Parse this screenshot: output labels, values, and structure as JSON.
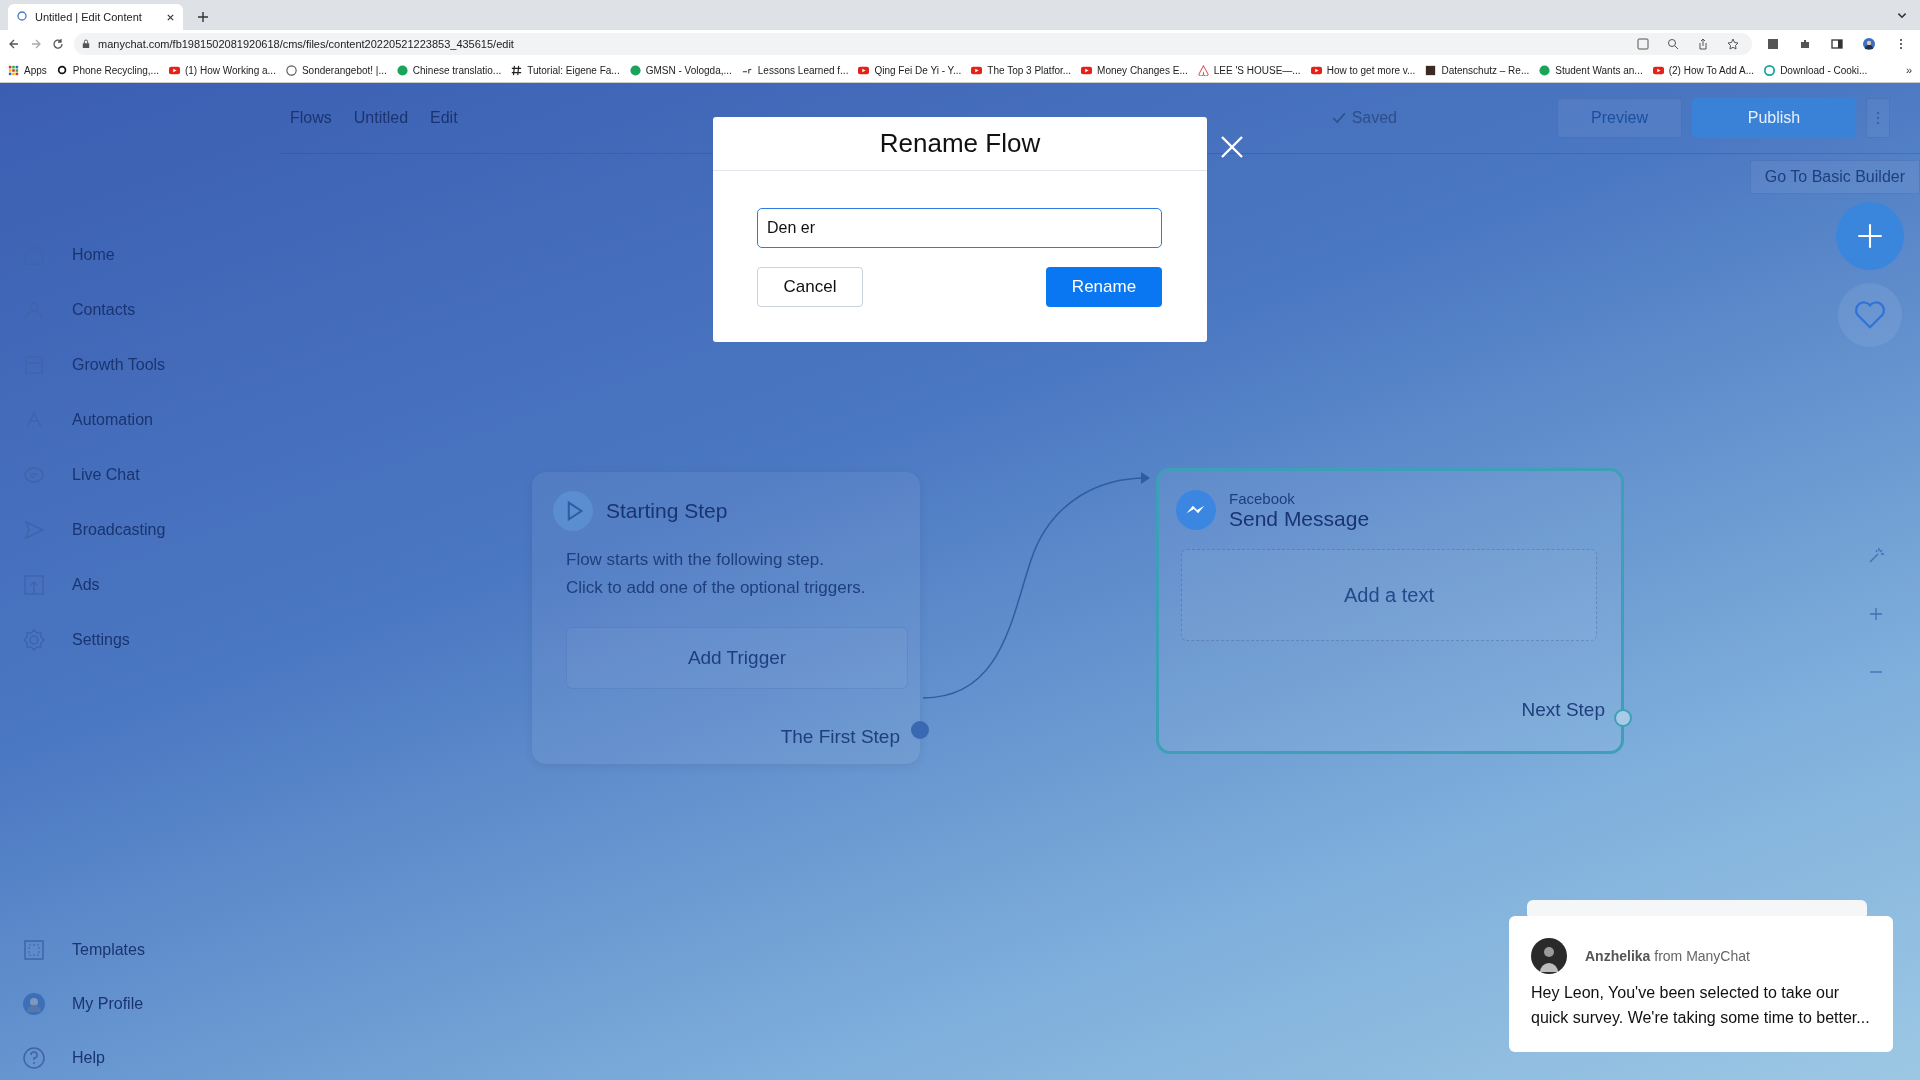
{
  "browser": {
    "tab": {
      "title": "Untitled | Edit Content"
    },
    "url": "manychat.com/fb1981502081920618/cms/files/content20220521223853_435615/edit",
    "bookmarks": [
      {
        "label": "Apps",
        "kind": "grid"
      },
      {
        "label": "Phone Recycling,...",
        "kind": "o2"
      },
      {
        "label": "(1) How Working a...",
        "kind": "youtube"
      },
      {
        "label": "Sonderangebot! |...",
        "kind": "circle"
      },
      {
        "label": "Chinese translatio...",
        "kind": "green"
      },
      {
        "label": "Tutorial: Eigene Fa...",
        "kind": "hash"
      },
      {
        "label": "GMSN - Vologda,...",
        "kind": "green"
      },
      {
        "label": "Lessons Learned f...",
        "kind": "text"
      },
      {
        "label": "Qing Fei De Yi - Y...",
        "kind": "youtube"
      },
      {
        "label": "The Top 3 Platfor...",
        "kind": "youtube"
      },
      {
        "label": "Money Changes E...",
        "kind": "youtube"
      },
      {
        "label": "LEE 'S HOUSE—...",
        "kind": "airbnb"
      },
      {
        "label": "How to get more v...",
        "kind": "youtube"
      },
      {
        "label": "Datenschutz – Re...",
        "kind": "dark"
      },
      {
        "label": "Student Wants an...",
        "kind": "green"
      },
      {
        "label": "(2) How To Add A...",
        "kind": "youtube"
      },
      {
        "label": "Download - Cooki...",
        "kind": "teal"
      }
    ],
    "more": "»"
  },
  "sidebar": {
    "items": [
      {
        "label": "Home"
      },
      {
        "label": "Contacts"
      },
      {
        "label": "Growth Tools"
      },
      {
        "label": "Automation"
      },
      {
        "label": "Live Chat"
      },
      {
        "label": "Broadcasting"
      },
      {
        "label": "Ads"
      },
      {
        "label": "Settings"
      }
    ],
    "bottom_items": [
      {
        "label": "Templates"
      },
      {
        "label": "My Profile"
      },
      {
        "label": "Help"
      }
    ]
  },
  "header": {
    "breadcrumbs": [
      "Flows",
      "Untitled",
      "Edit"
    ],
    "status": "Saved",
    "preview": "Preview",
    "publish": "Publish",
    "basic_builder": "Go To Basic Builder"
  },
  "canvas": {
    "start_node": {
      "title": "Starting Step",
      "description": "Flow starts with the following step.\nClick to add one of the optional triggers.",
      "add_trigger": "Add Trigger",
      "output": "The First Step"
    },
    "message_node": {
      "channel": "Facebook",
      "title": "Send Message",
      "placeholder": "Add a text",
      "output": "Next Step"
    }
  },
  "dialog": {
    "title": "Rename Flow",
    "value": "Den er",
    "cancel": "Cancel",
    "confirm": "Rename"
  },
  "chat_popup": {
    "sender": "Anzhelika",
    "sender_suffix": "from ManyChat",
    "message": "Hey Leon,  You've been selected to take our quick survey. We're taking some time to better..."
  }
}
